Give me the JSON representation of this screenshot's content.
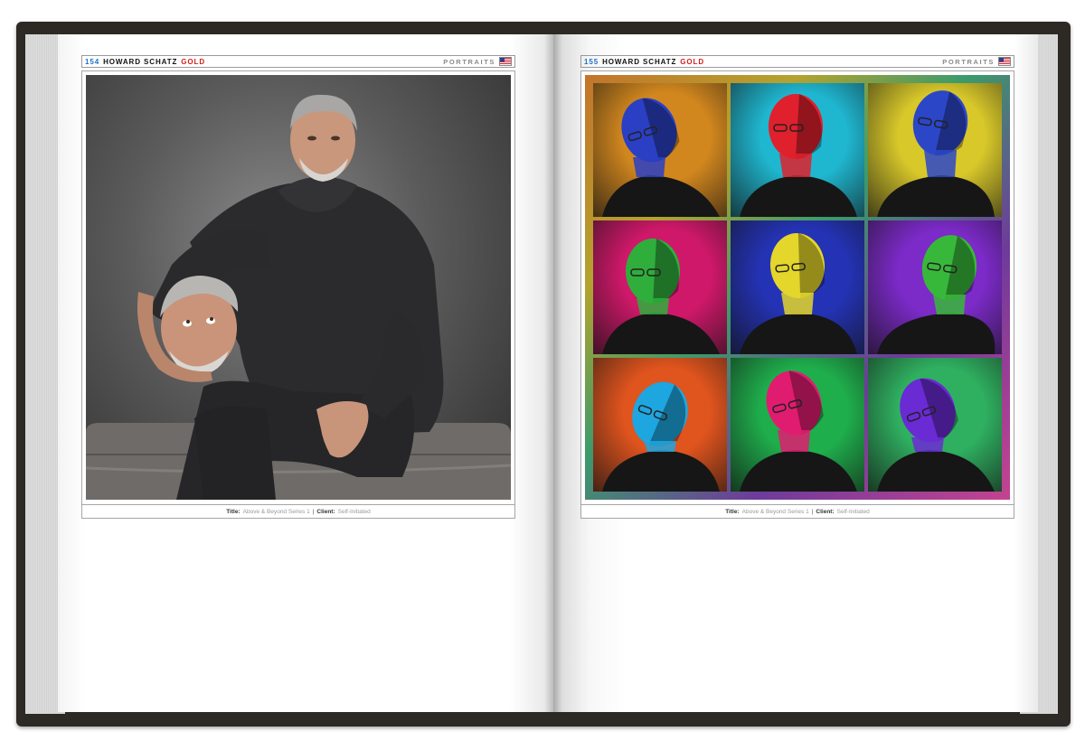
{
  "left_page": {
    "page_number": "154",
    "author": "HOWARD SCHATZ",
    "edition": "GOLD",
    "section": "PORTRAITS",
    "caption": {
      "title_label": "Title:",
      "title": "Above & Beyond Series 1",
      "separator": "|",
      "client_label": "Client:",
      "client": "Self-Initiated"
    }
  },
  "right_page": {
    "page_number": "155",
    "author": "HOWARD SCHATZ",
    "edition": "GOLD",
    "section": "PORTRAITS",
    "caption": {
      "title_label": "Title:",
      "title": "Above & Beyond Series 1",
      "separator": "|",
      "client_label": "Client:",
      "client": "Self-Initiated"
    },
    "tiles": [
      {
        "bg": "#d2871e",
        "light": "#2a3fc4"
      },
      {
        "bg": "#1fb6cf",
        "light": "#e0202c"
      },
      {
        "bg": "#d8c82a",
        "light": "#2c46c8"
      },
      {
        "bg": "#d0186a",
        "light": "#2fae3c"
      },
      {
        "bg": "#2433b6",
        "light": "#e4d62a"
      },
      {
        "bg": "#7c2ac8",
        "light": "#38b83a"
      },
      {
        "bg": "#e0541e",
        "light": "#1ea6e0"
      },
      {
        "bg": "#1fae4c",
        "light": "#e01c70"
      },
      {
        "bg": "#2fb060",
        "light": "#6a2ad4"
      }
    ]
  },
  "colors": {
    "page_number": "#1d72c4",
    "edition": "#d0201f",
    "cover": "#2d2925"
  },
  "icons": {
    "flag": "us-flag-icon"
  }
}
